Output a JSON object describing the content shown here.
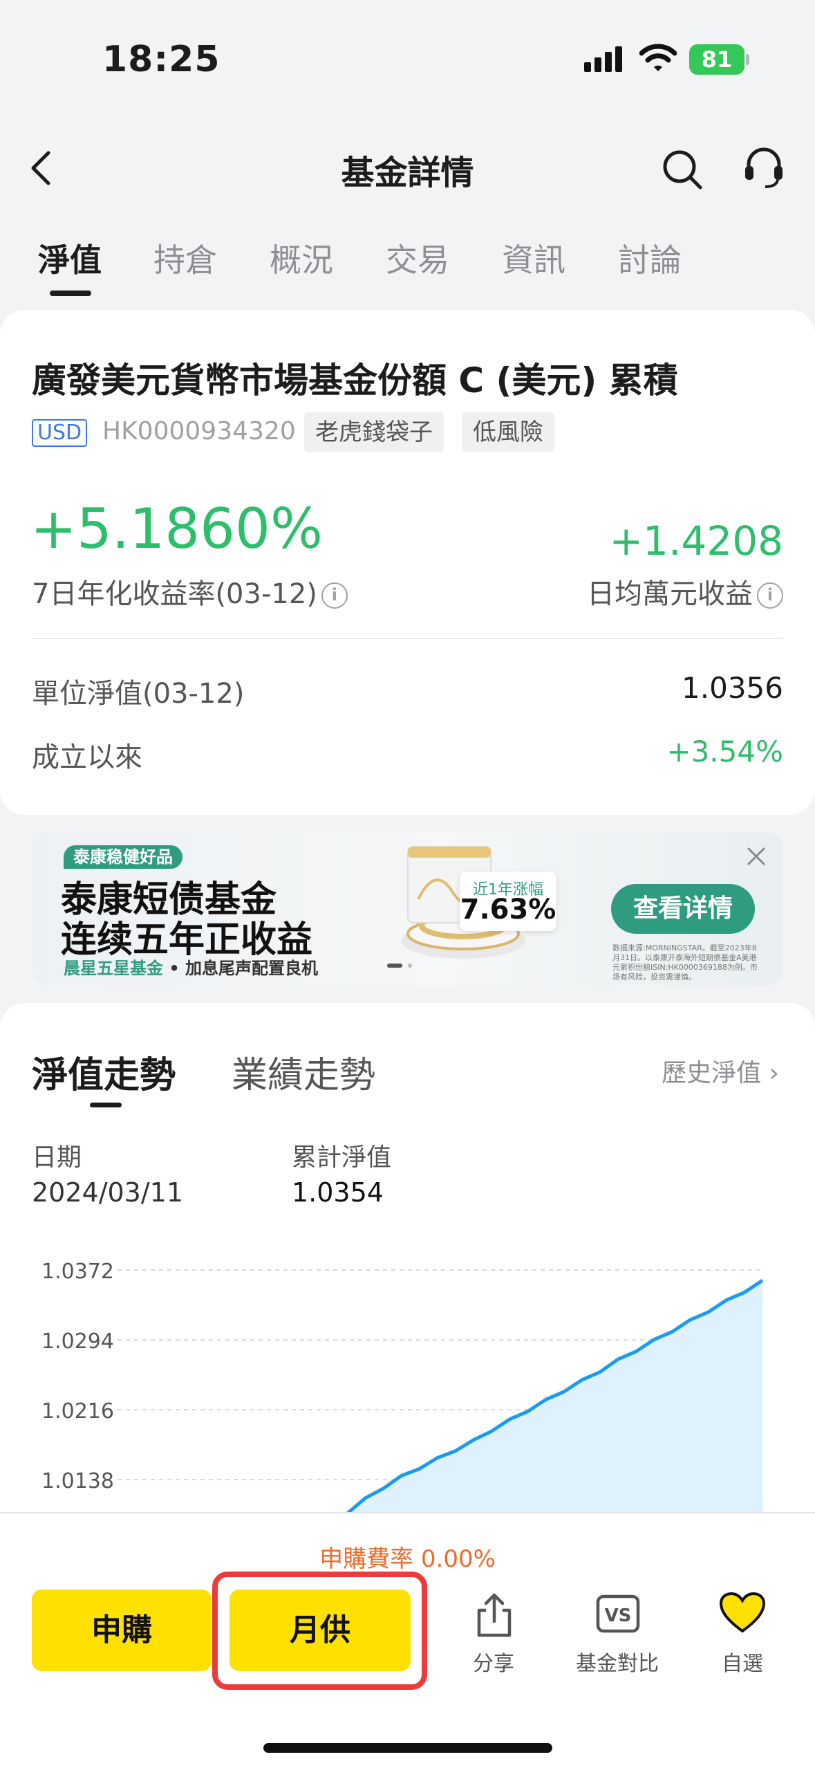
{
  "status_bar": {
    "time": "18:25",
    "battery": "81"
  },
  "nav": {
    "title": "基金詳情"
  },
  "tabs": [
    {
      "label": "淨值",
      "active": true
    },
    {
      "label": "持倉"
    },
    {
      "label": "概況"
    },
    {
      "label": "交易"
    },
    {
      "label": "資訊"
    },
    {
      "label": "討論"
    }
  ],
  "fund": {
    "name": "廣發美元貨幣市場基金份額 C (美元) 累積",
    "currency": "USD",
    "code": "HK0000934320",
    "tags": [
      "老虎錢袋子",
      "低風險"
    ],
    "yield_value": "+5.1860%",
    "yield_label": "7日年化收益率(03-12)",
    "daily_value": "+1.4208",
    "daily_label": "日均萬元收益",
    "nav_label": "單位淨值(03-12)",
    "nav_value": "1.0356",
    "since_label": "成立以來",
    "since_value": "+3.54%"
  },
  "ad": {
    "badge": "泰康稳健好品",
    "line1": "泰康短债基金",
    "line2": "连续五年正收益",
    "line3_green": "晨星五星基金",
    "line3_rest": " • 加息尾声配置良机",
    "stat_label": "近1年涨幅",
    "stat_value": "7.63%",
    "cta": "查看详情",
    "disclaimer": "数据来源:MORNINGSTAR。截至2023年8月31日。以泰康开泰海外短期债基金A美港元累积份额ISIN:HK0000369188为例。市场有风险，投资需谨慎。"
  },
  "chart_section": {
    "tab_nav": "淨值走勢",
    "tab_perf": "業績走勢",
    "history_link": "歷史淨值",
    "date_label": "日期",
    "date_value": "2024/03/11",
    "acc_label": "累計淨值",
    "acc_value": "1.0354"
  },
  "chart_data": {
    "type": "area",
    "y_ticks": [
      "1.0372",
      "1.0294",
      "1.0216",
      "1.0138"
    ],
    "ylim": [
      1.006,
      1.0372
    ],
    "series": [
      {
        "values": [
          1.006,
          1.008,
          1.01,
          1.0115,
          1.0128,
          1.014,
          1.015,
          1.016,
          1.017,
          1.018,
          1.0192,
          1.0203,
          1.0214,
          1.0225,
          1.0236,
          1.0247,
          1.0258,
          1.027,
          1.0281,
          1.0292,
          1.0303,
          1.0314,
          1.0325,
          1.0336,
          1.0347,
          1.0358
        ]
      }
    ],
    "line_color": "#1a9bf0",
    "fill_color": "#dff1fc"
  },
  "bottom": {
    "fee": "申購費率 0.00%",
    "subscribe": "申購",
    "monthly": "月供",
    "share": "分享",
    "compare": "基金對比",
    "watchlist": "自選"
  }
}
